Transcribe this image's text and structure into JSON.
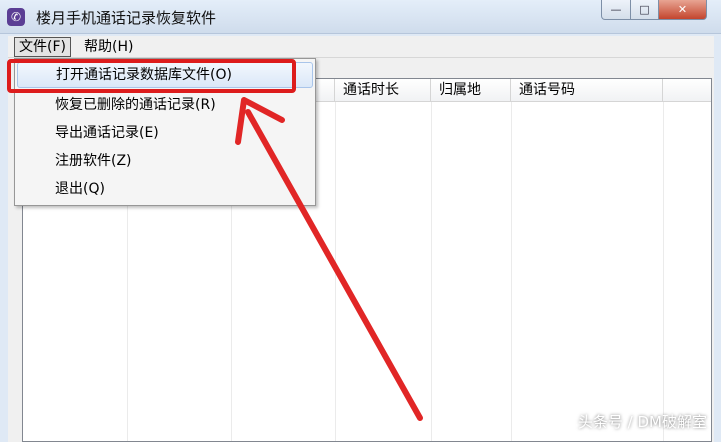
{
  "window": {
    "title": "楼月手机通话记录恢复软件",
    "minimize_glyph": "—",
    "maximize_glyph": "□",
    "close_glyph": "✕"
  },
  "menubar": {
    "file_label": "文件(F)",
    "help_label": "帮助(H)"
  },
  "file_menu": {
    "items": [
      "打开通话记录数据库文件(O)",
      "恢复已删除的通话记录(R)",
      "导出通话记录(E)",
      "注册软件(Z)",
      "退出(Q)"
    ],
    "highlighted_index": 0
  },
  "table": {
    "columns": [
      "通话时长",
      "归属地",
      "通话号码"
    ]
  },
  "annotation": {
    "highlight_color": "#dd1c1c"
  },
  "watermark": "头条号 / DM破解室"
}
